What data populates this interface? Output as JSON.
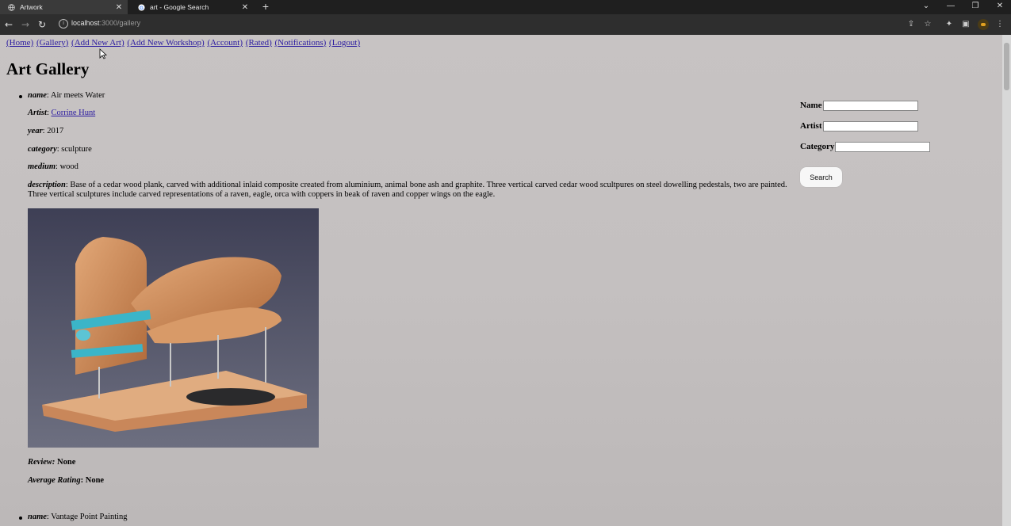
{
  "browser": {
    "tabs": [
      {
        "title": "Artwork",
        "active": true
      },
      {
        "title": "art - Google Search",
        "active": false
      }
    ],
    "url_host": "localhost",
    "url_path": ":3000/gallery"
  },
  "nav": {
    "links": [
      "(Home)",
      "(Gallery)",
      "(Add New Art)",
      "(Add New Workshop)",
      "(Account)",
      "(Rated)",
      "(Notifications)",
      "(Logout)"
    ]
  },
  "page": {
    "title": "Art Gallery"
  },
  "artwork": {
    "name_label": "name",
    "name": "Air meets Water",
    "artist_label": "Artist",
    "artist": "Corrine Hunt",
    "year_label": "year",
    "year": "2017",
    "category_label": "category",
    "category": "sculpture",
    "medium_label": "medium",
    "medium": "wood",
    "description_label": "description",
    "description": "Base of a cedar wood plank, carved with additional inlaid composite created from aluminium, animal bone ash and graphite. Three vertical carved cedar wood scultpures on steel dowelling pedestals, two are painted. Three vertical sculptures include carved representations of a raven, eagle, orca with coppers in beak of raven and copper wings on the eagle.",
    "review_label": "Review:",
    "review": "None",
    "rating_label": "Average Rating",
    "rating": "None"
  },
  "next_artwork": {
    "name_label": "name",
    "name": "Vantage Point Painting"
  },
  "search": {
    "name_label": "Name",
    "artist_label": "Artist",
    "category_label": "Category",
    "name_value": "",
    "artist_value": "",
    "category_value": "",
    "button_label": "Search"
  },
  "colors": {
    "link": "#2a1aa0",
    "page_bg": "#c3c0c0",
    "chrome_bg": "#1f1f1f"
  }
}
